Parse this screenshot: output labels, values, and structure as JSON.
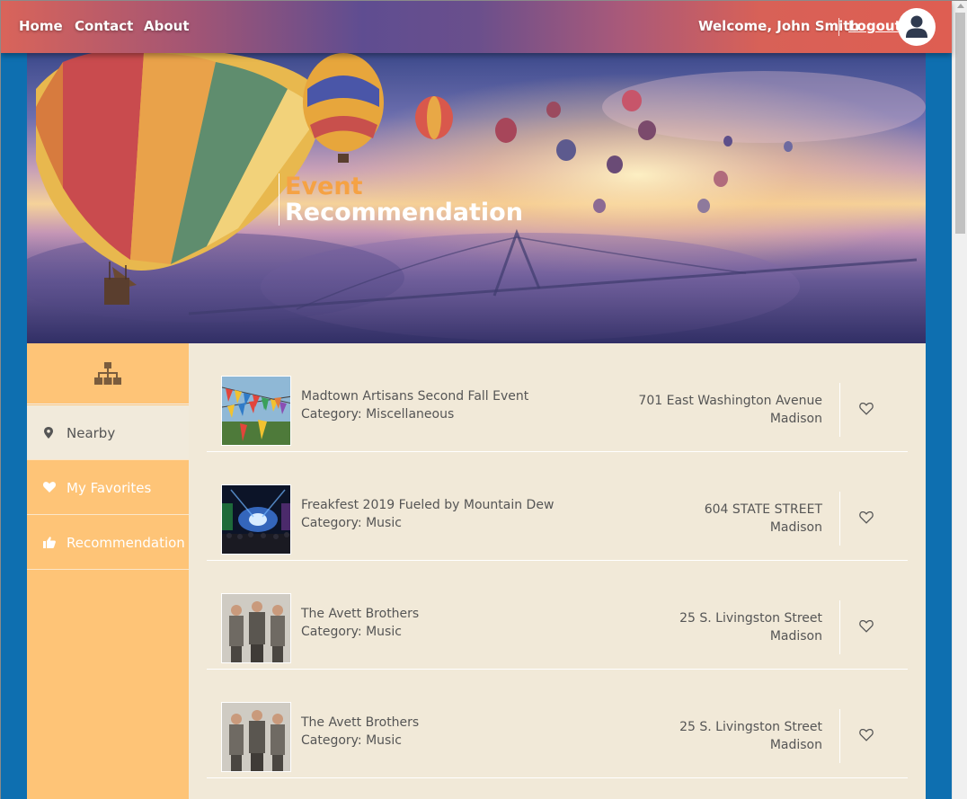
{
  "nav": {
    "home": "Home",
    "contact": "Contact",
    "about": "About",
    "welcome": "Welcome, John Smith",
    "logout": "Logout",
    "avatar_icon": "user-avatar-icon"
  },
  "hero": {
    "title_line1": "Event",
    "title_line2": "Recommendation"
  },
  "sidebar": {
    "head_icon": "sitemap-icon",
    "items": [
      {
        "label": "Nearby",
        "icon": "map-marker-icon",
        "active": true
      },
      {
        "label": "My Favorites",
        "icon": "heart-icon",
        "active": false
      },
      {
        "label": "Recommendation",
        "icon": "thumbs-up-icon",
        "active": false
      }
    ]
  },
  "events": [
    {
      "name": "Madtown Artisans Second Fall Event",
      "category": "Category: Miscellaneous",
      "address": "701 East Washington Avenue",
      "city": "Madison",
      "thumb": "flags"
    },
    {
      "name": "Freakfest 2019 Fueled by Mountain Dew",
      "category": "Category: Music",
      "address": "604 STATE STREET",
      "city": "Madison",
      "thumb": "concert"
    },
    {
      "name": "The Avett Brothers",
      "category": "Category: Music",
      "address": "25 S. Livingston Street",
      "city": "Madison",
      "thumb": "band"
    },
    {
      "name": "The Avett Brothers",
      "category": "Category: Music",
      "address": "25 S. Livingston Street",
      "city": "Madison",
      "thumb": "band"
    }
  ],
  "colors": {
    "accent_orange": "#f5a244",
    "sidebar_bg": "#fec477",
    "main_bg": "#f1e9d8",
    "page_bg": "#0e6fb0"
  }
}
